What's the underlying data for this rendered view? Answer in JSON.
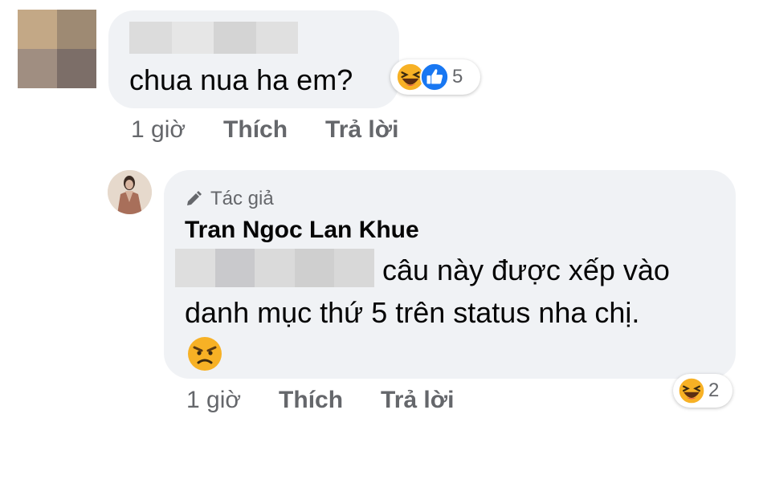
{
  "comment1": {
    "text": "chua nua ha em?",
    "reactions": {
      "icons": [
        "laugh-emoji",
        "like-icon"
      ],
      "count": "5"
    },
    "meta": {
      "time": "1 giờ",
      "like": "Thích",
      "reply": "Trả lời"
    }
  },
  "comment2": {
    "author_badge": "Tác giả",
    "author_name": "Tran Ngoc Lan Khue",
    "text_line1": "câu này được xếp vào",
    "text_line2": "danh mục thứ 5 trên status nha chị.",
    "emoji": "angry-emoji",
    "reactions": {
      "icons": [
        "laugh-emoji"
      ],
      "count": "2"
    },
    "meta": {
      "time": "1 giờ",
      "like": "Thích",
      "reply": "Trả lời"
    }
  },
  "colors": {
    "bubble": "#f0f2f5",
    "meta_text": "#65676b",
    "like_blue": "#1877f2",
    "emoji_yellow": "#f7b125"
  }
}
